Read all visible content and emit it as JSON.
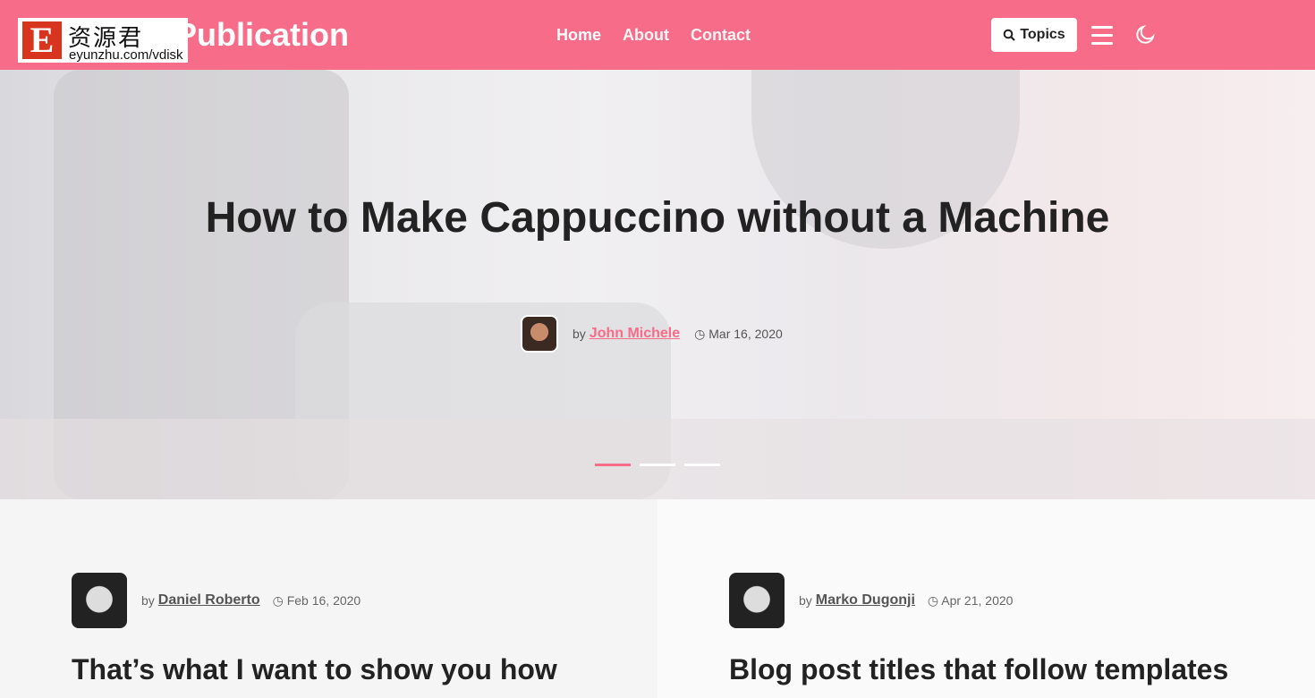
{
  "header": {
    "brand": "Publication",
    "watermark": {
      "letter": "E",
      "chinese": "资源君",
      "url": "eyunzhu.com/vdisk"
    },
    "nav": [
      {
        "label": "Home"
      },
      {
        "label": "About"
      },
      {
        "label": "Contact"
      }
    ],
    "topics_label": "Topics",
    "icons": [
      "search-icon",
      "menu-icon",
      "moon-icon"
    ],
    "accent": "#f76c88"
  },
  "hero": {
    "title": "How to Make Cappuccino without a Machine",
    "by": "by",
    "author": "John Michele",
    "date": "Mar 16, 2020",
    "slides": 3,
    "active_slide": 1
  },
  "posts": [
    {
      "by": "by",
      "author": "Daniel Roberto",
      "date": "Feb 16, 2020",
      "title": "That’s what I want to show you how"
    },
    {
      "by": "by",
      "author": "Marko Dugonji",
      "date": "Apr 21, 2020",
      "title": "Blog post titles that follow templates"
    }
  ]
}
